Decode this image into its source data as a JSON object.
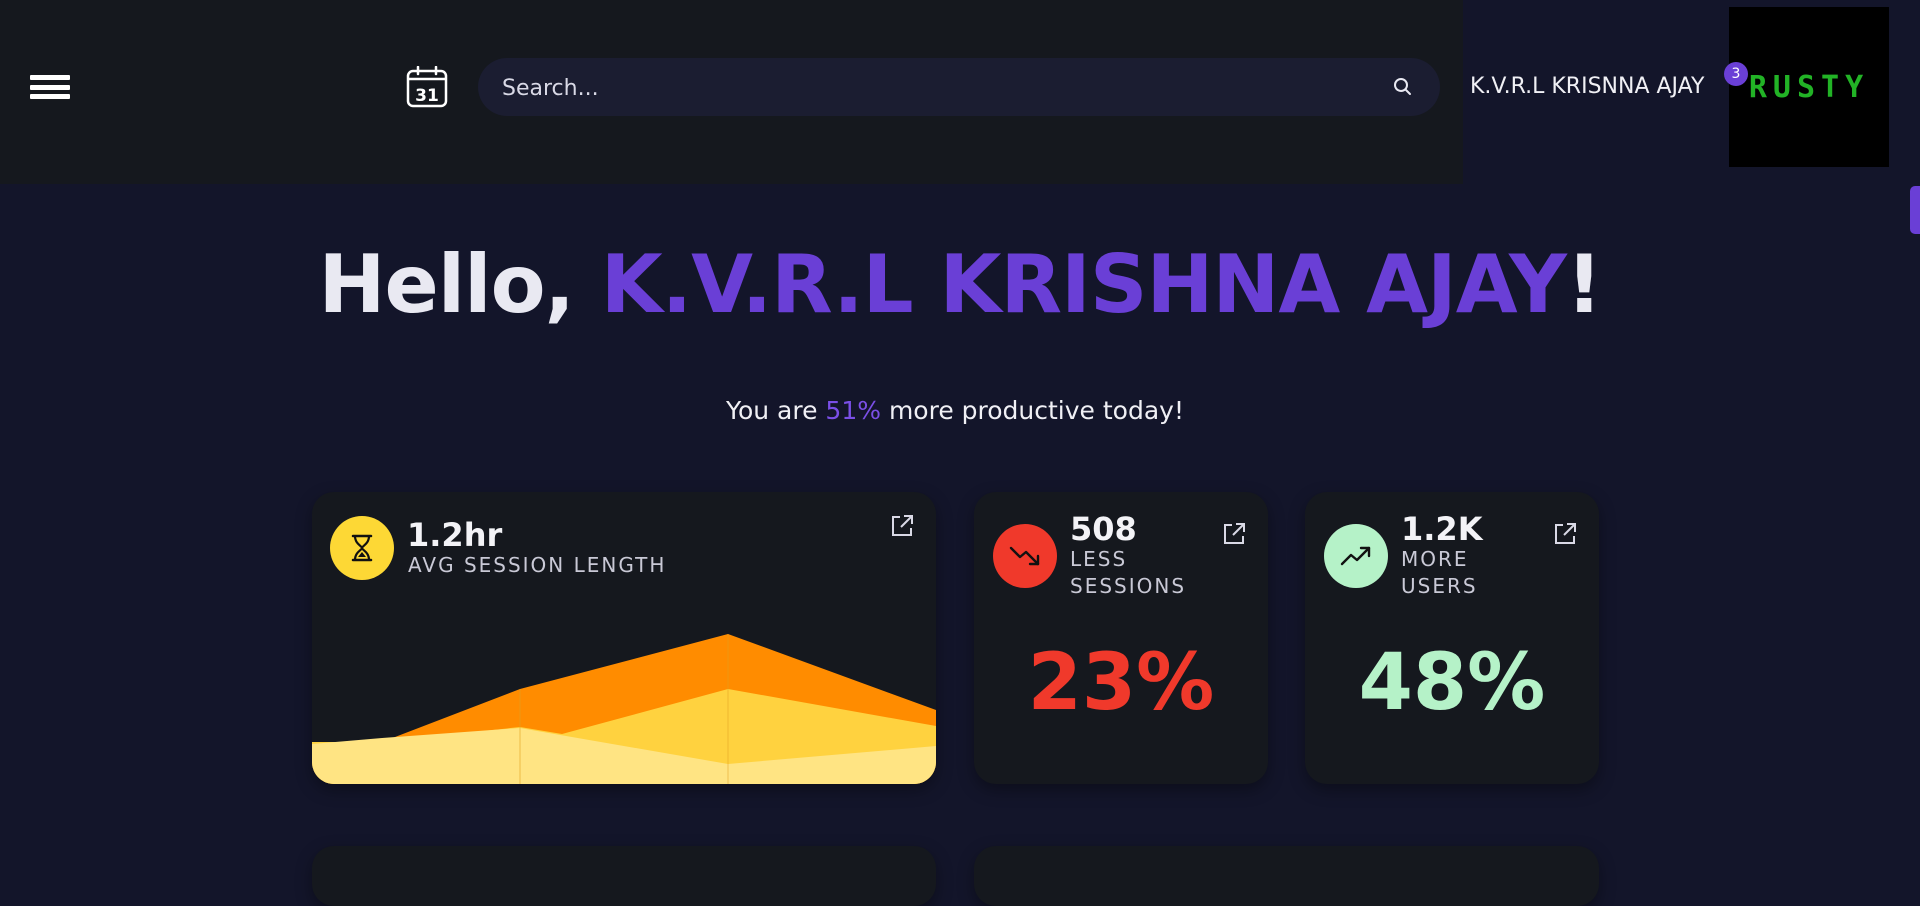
{
  "header": {
    "search_placeholder": "Search...",
    "calendar_day": "31",
    "user_name": "K.V.R.L KRISNNA AJAY",
    "notification_count": "3",
    "logo_text": "RUSTY"
  },
  "greeting": {
    "prefix": "Hello, ",
    "name": "K.V.R.L KRISHNA AJAY",
    "suffix": "!"
  },
  "subtitle": {
    "before": "You are ",
    "percent": "51%",
    "after": " more productive today!"
  },
  "cards": {
    "session": {
      "value": "1.2hr",
      "label": "AVG SESSION LENGTH",
      "icon": "hourglass-icon"
    },
    "sessions": {
      "value": "508",
      "label_line1": "LESS",
      "label_line2": "SESSIONS",
      "percent": "23%",
      "icon": "trend-down-icon"
    },
    "users": {
      "value": "1.2K",
      "label_line1": "MORE",
      "label_line2": "USERS",
      "percent": "48%",
      "icon": "trend-up-icon"
    }
  },
  "colors": {
    "background": "#13152a",
    "topbar": "#15181e",
    "accent": "#6a3fd6",
    "card": "#15181e",
    "hourglass_bg": "#fdd835",
    "down_bg": "#f0392b",
    "down_text": "#f0392b",
    "up_bg": "#b5f2c8",
    "up_text": "#b5f2c8",
    "logo_green": "#22b326",
    "area_orange": "#ff8c00",
    "area_yellow": "#ffd23f",
    "area_light": "#ffe483"
  }
}
